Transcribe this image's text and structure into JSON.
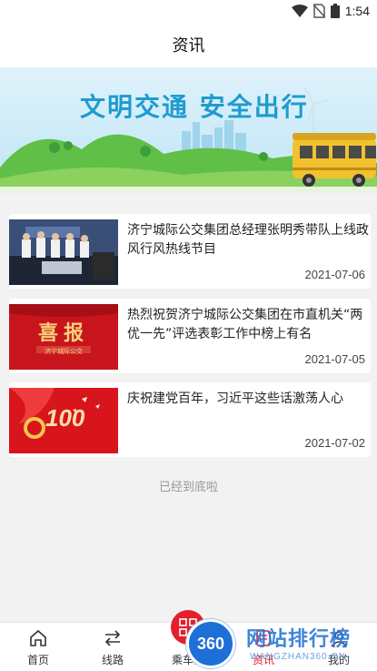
{
  "status_bar": {
    "time": "1:54"
  },
  "header": {
    "title": "资讯"
  },
  "banner": {
    "headline": "文明交通  安全出行"
  },
  "news": [
    {
      "title": "济宁城际公交集团总经理张明秀带队上线政风行风热线节目",
      "date": "2021-07-06",
      "thumb": "photo"
    },
    {
      "title": "热烈祝贺济宁城际公交集团在市直机关“两优一先”评选表彰工作中榜上有名",
      "date": "2021-07-05",
      "thumb": "announcement",
      "thumb_text": "喜报",
      "thumb_sub": "济宁城际公交"
    },
    {
      "title": "庆祝建党百年，习近平这些话激荡人心",
      "date": "2021-07-02",
      "thumb": "anniversary",
      "thumb_text": "100"
    }
  ],
  "list_end_text": "已经到底啦",
  "bottom_nav": [
    {
      "label": "首页",
      "icon": "home-icon"
    },
    {
      "label": "线路",
      "icon": "route-arrows-icon"
    },
    {
      "label": "乘车码",
      "icon": "qr-code-icon"
    },
    {
      "label": "资讯",
      "icon": "news-icon"
    },
    {
      "label": "我的",
      "icon": "profile-icon"
    }
  ],
  "watermark": {
    "logo_text": "360",
    "title": "网站排行榜",
    "subtitle": "WANGZHAN360.CN"
  },
  "colors": {
    "accent_red": "#e51f2c",
    "banner_blue": "#1f9bd0"
  }
}
